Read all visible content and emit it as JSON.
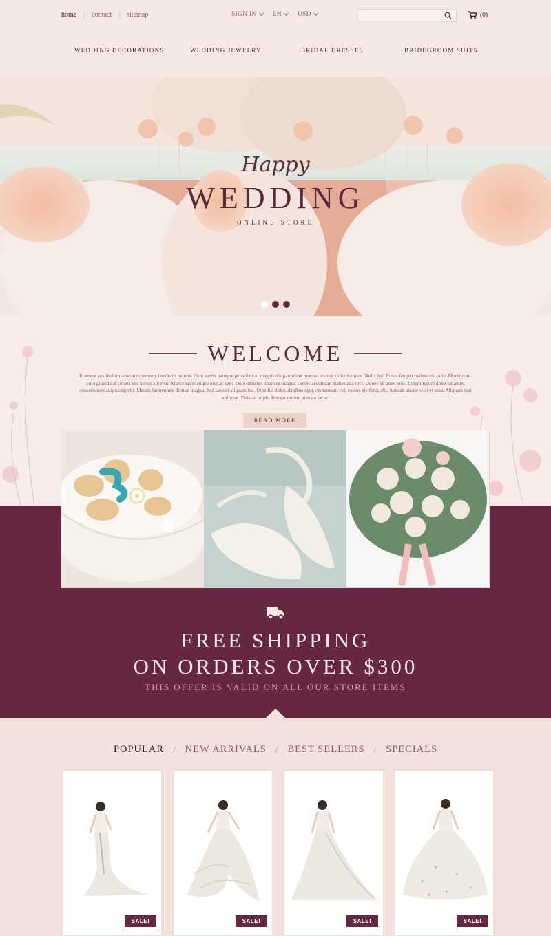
{
  "header": {
    "top_links": [
      "home",
      "contact",
      "sitemap"
    ],
    "sign_in": "SIGN IN",
    "language": "EN",
    "currency": "USD",
    "search_placeholder": "",
    "cart_count": "(0)",
    "nav": [
      "WEDDING DECORATIONS",
      "WEDDING JEWELRY",
      "BRIDAL DRESSES",
      "BRIDEGROOM SUITS"
    ]
  },
  "hero": {
    "script_text": "Happy",
    "title": "WEDDING",
    "subtitle": "ONLINE STORE",
    "slides": 3,
    "active_slide": 1
  },
  "welcome": {
    "title": "WELCOME",
    "body": "Praesent vestibulum aenean nonummy hendrerit mauris. Cum sociis natoque penatibus et magnis dis parturient montes ascetur ridiculus mus. Nulla dui. Fusce feugiat malesuada odio. Morbi nunc odio gravida at cursus nec luctus a lorem. Maecenas tristique orci ac sem. Duis ultricies pharetra magna. Donec accumsan malesuada orci. Donec sit amet eros. Lorem ipsum dolor sit amet, consectetuer adipiscing elit. Mauris fermentum dictum magna. Sed laoreet aliquam leo. Ut tellus dolor, dapibus eget, elementum vel, cursus eleifend, elit. Aenean auctor wisi et urna. Aliquam erat volutpat. Duis ac turpis. Integer rutrum ante eu lacus.",
    "button": "READ MORE"
  },
  "gallery": [
    "wedding-cake",
    "bridal-shoes",
    "rose-bouquet"
  ],
  "shipping": {
    "line1": "FREE SHIPPING",
    "line2": "ON ORDERS OVER $300",
    "note": "THIS OFFER IS VALID ON ALL OUR STORE ITEMS"
  },
  "products": {
    "tabs": [
      "POPULAR",
      "NEW ARRIVALS",
      "BEST SELLERS",
      "SPECIALS"
    ],
    "active_tab": "POPULAR",
    "items": [
      {
        "badge": "SALE!"
      },
      {
        "badge": "SALE!"
      },
      {
        "badge": "SALE!"
      },
      {
        "badge": "SALE!"
      }
    ]
  },
  "colors": {
    "accent": "#672642",
    "background": "#f5e6e1",
    "text": "#5a2a3a"
  }
}
